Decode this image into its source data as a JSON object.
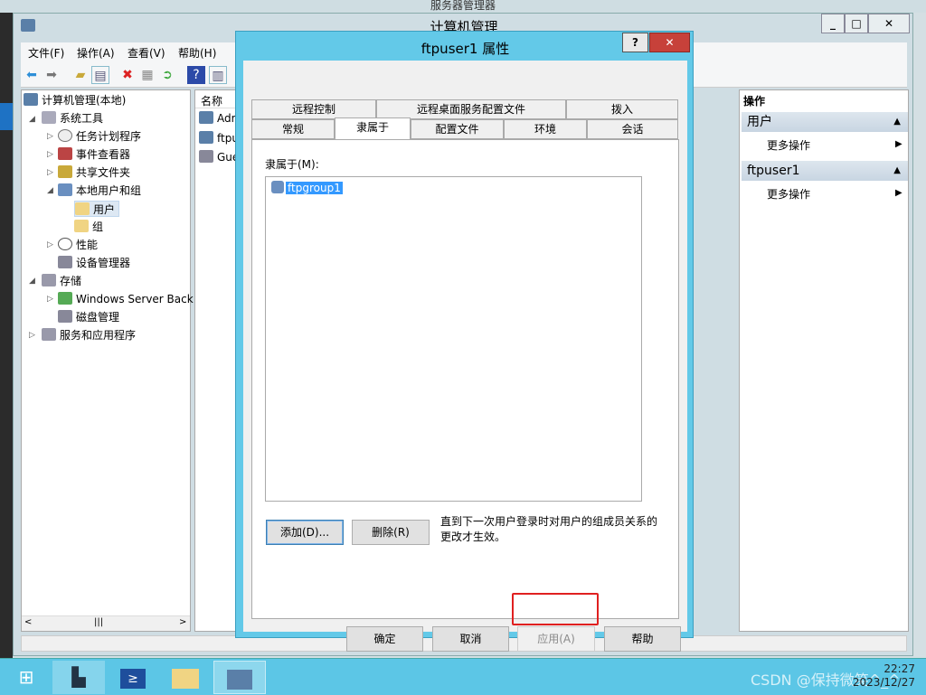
{
  "background_window": {
    "title": "服务器管理器"
  },
  "mmc": {
    "title": "计算机管理",
    "window_buttons": [
      "_",
      "□",
      "✕"
    ],
    "menu": [
      "文件(F)",
      "操作(A)",
      "查看(V)",
      "帮助(H)"
    ],
    "tree": [
      {
        "label": "计算机管理(本地)",
        "icon": "computer-icon"
      },
      {
        "label": "系统工具",
        "icon": "tools-icon"
      },
      {
        "label": "任务计划程序",
        "icon": "clock-icon"
      },
      {
        "label": "事件查看器",
        "icon": "event-viewer-icon"
      },
      {
        "label": "共享文件夹",
        "icon": "shared-folder-icon"
      },
      {
        "label": "本地用户和组",
        "icon": "users-icon"
      },
      {
        "label": "用户",
        "icon": "folder-icon"
      },
      {
        "label": "组",
        "icon": "folder-icon"
      },
      {
        "label": "性能",
        "icon": "performance-icon"
      },
      {
        "label": "设备管理器",
        "icon": "device-manager-icon"
      },
      {
        "label": "存储",
        "icon": "storage-icon"
      },
      {
        "label": "Windows Server Back",
        "icon": "backup-icon"
      },
      {
        "label": "磁盘管理",
        "icon": "disk-icon"
      },
      {
        "label": "服务和应用程序",
        "icon": "services-icon"
      }
    ],
    "list": {
      "column": "名称",
      "items": [
        "Adm",
        "ftpu",
        "Gue"
      ]
    },
    "actions": {
      "header": "操作",
      "sections": [
        {
          "title": "用户",
          "item": "更多操作"
        },
        {
          "title": "ftpuser1",
          "item": "更多操作"
        }
      ]
    }
  },
  "dialog": {
    "title": "ftpuser1 属性",
    "help": "?",
    "close": "✕",
    "tabs_row1": [
      "远程控制",
      "远程桌面服务配置文件",
      "拨入"
    ],
    "tabs_row2": [
      "常规",
      "隶属于",
      "配置文件",
      "环境",
      "会话"
    ],
    "selected_tab": "隶属于",
    "member_of_label": "隶属于(M):",
    "groups": [
      "ftpgroup1"
    ],
    "add": "添加(D)...",
    "remove": "删除(R)",
    "note": "直到下一次用户登录时对用户的组成员关系的更改才生效。",
    "ok": "确定",
    "cancel": "取消",
    "apply": "应用(A)",
    "help_button": "帮助"
  },
  "taskbar": {
    "time": "22:27",
    "date": "2023/12/27",
    "watermark": "CSDN @保持微笑^_^"
  },
  "colors": {
    "dialog_frame": "#63c9e8",
    "taskbar": "#5cc6e6",
    "selection": "#3399ff",
    "highlight_box": "#e02020",
    "close": "#c7413a"
  }
}
